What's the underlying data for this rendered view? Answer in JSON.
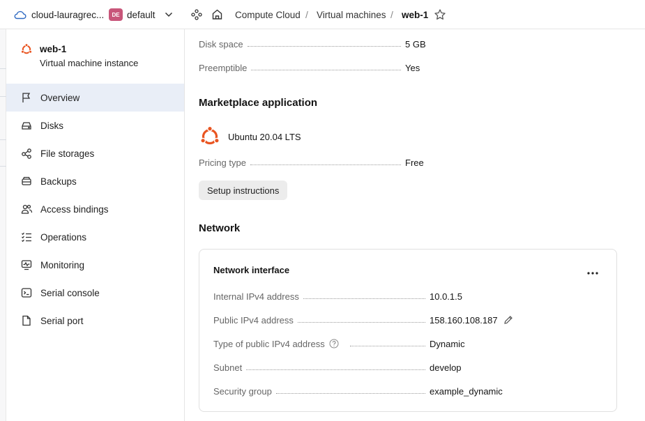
{
  "header": {
    "cloud_name": "cloud-lauragrec...",
    "folder_badge": "DE",
    "folder_name": "default",
    "breadcrumbs": [
      "Compute Cloud",
      "Virtual machines",
      "web-1"
    ],
    "separator": "/"
  },
  "sidebar": {
    "vm_name": "web-1",
    "vm_type": "Virtual machine instance",
    "items": [
      {
        "label": "Overview",
        "icon": "flag-icon",
        "active": true
      },
      {
        "label": "Disks",
        "icon": "disk-icon"
      },
      {
        "label": "File storages",
        "icon": "share-nodes-icon"
      },
      {
        "label": "Backups",
        "icon": "backup-icon"
      },
      {
        "label": "Access bindings",
        "icon": "persons-icon"
      },
      {
        "label": "Operations",
        "icon": "list-check-icon"
      },
      {
        "label": "Monitoring",
        "icon": "monitor-chart-icon"
      },
      {
        "label": "Serial console",
        "icon": "terminal-icon"
      },
      {
        "label": "Serial port",
        "icon": "file-icon"
      }
    ]
  },
  "main": {
    "disk_space_label": "Disk space",
    "disk_space_value": "5 GB",
    "preemptible_label": "Preemptible",
    "preemptible_value": "Yes",
    "marketplace_title": "Marketplace application",
    "app_name": "Ubuntu 20.04 LTS",
    "pricing_label": "Pricing type",
    "pricing_value": "Free",
    "setup_button": "Setup instructions",
    "network_title": "Network",
    "network_card": {
      "title": "Network interface",
      "internal_ip_label": "Internal IPv4 address",
      "internal_ip_value": "10.0.1.5",
      "public_ip_label": "Public IPv4 address",
      "public_ip_value": "158.160.108.187",
      "public_ip_type_label": "Type of public IPv4 address",
      "public_ip_type_value": "Dynamic",
      "subnet_label": "Subnet",
      "subnet_value": "develop",
      "security_group_label": "Security group",
      "security_group_value": "example_dynamic"
    }
  },
  "colors": {
    "accent_link": "#2f6ac2",
    "active_nav_bg": "#e9eef7",
    "ubuntu_orange": "#e95420",
    "folder_badge": "#c8567a"
  }
}
